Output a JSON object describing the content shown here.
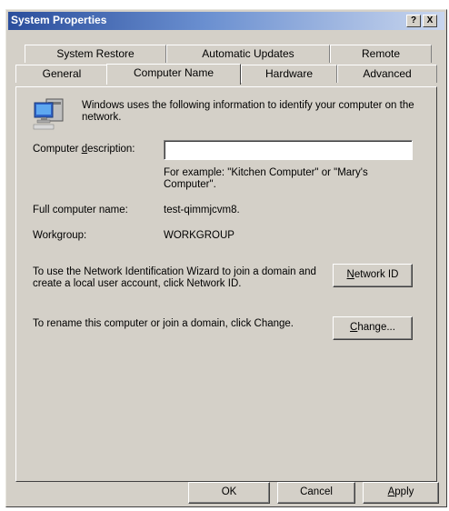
{
  "window": {
    "title": "System Properties",
    "help_button": "?",
    "close_button": "X"
  },
  "tabs": {
    "row1": [
      "System Restore",
      "Automatic Updates",
      "Remote"
    ],
    "row2": [
      "General",
      "Computer Name",
      "Hardware",
      "Advanced"
    ],
    "active": "Computer Name"
  },
  "computer_name": {
    "intro": "Windows uses the following information to identify your computer on the network.",
    "description_label_pre": "Computer ",
    "description_label_key": "d",
    "description_label_post": "escription:",
    "description_value": "",
    "example": "For example: \"Kitchen Computer\" or \"Mary's Computer\".",
    "full_name_label": "Full computer name:",
    "full_name_value": "test-qimmjcvm8.",
    "workgroup_label": "Workgroup:",
    "workgroup_value": "WORKGROUP",
    "network_id_text": "To use the Network Identification Wizard to join a domain and create a local user account, click Network ID.",
    "network_id_key": "N",
    "network_id_rest": "etwork ID",
    "rename_text": "To rename this computer or join a domain, click Change.",
    "change_key": "C",
    "change_rest": "hange..."
  },
  "footer": {
    "ok": "OK",
    "cancel": "Cancel",
    "apply_key": "A",
    "apply_rest": "pply"
  }
}
